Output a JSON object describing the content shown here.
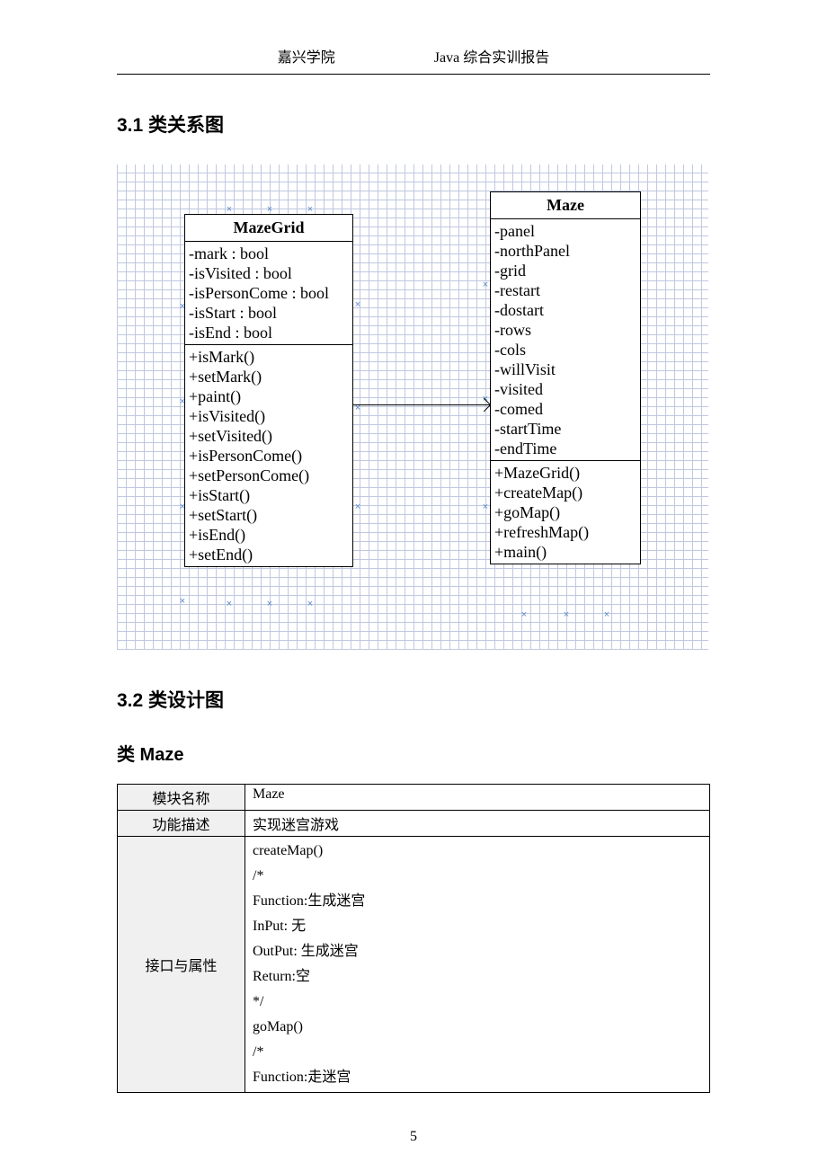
{
  "header": {
    "left": "嘉兴学院",
    "right": "Java 综合实训报告"
  },
  "sections": {
    "s31": "3.1 类关系图",
    "s32": "3.2 类设计图",
    "classMaze": "类 Maze"
  },
  "uml": {
    "mazeGrid": {
      "name": "MazeGrid",
      "attrs": [
        "-mark : bool",
        "-isVisited : bool",
        "-isPersonCome : bool",
        "-isStart : bool",
        "-isEnd : bool"
      ],
      "ops": [
        "+isMark()",
        "+setMark()",
        "+paint()",
        "+isVisited()",
        "+setVisited()",
        "+isPersonCome()",
        "+setPersonCome()",
        "+isStart()",
        "+setStart()",
        "+isEnd()",
        "+setEnd()"
      ]
    },
    "maze": {
      "name": "Maze",
      "attrs": [
        "-panel",
        "-northPanel",
        "-grid",
        "-restart",
        "-dostart",
        "-rows",
        "-cols",
        "-willVisit",
        "-visited",
        "-comed",
        "-startTime",
        "-endTime"
      ],
      "ops": [
        "+MazeGrid()",
        "+createMap()",
        "+goMap()",
        "+refreshMap()",
        "+main()"
      ]
    }
  },
  "table": {
    "rows": {
      "moduleLabel": "模块名称",
      "moduleValue": "Maze",
      "funcLabel": "功能描述",
      "funcValue": "实现迷宫游戏",
      "attrLabel": "接口与属性",
      "attrLines": [
        "createMap()",
        "/*",
        "Function:生成迷宫",
        "InPut:  无",
        "OutPut:  生成迷宫",
        "Return:空",
        "*/",
        "goMap()",
        "/*",
        "Function:走迷宫"
      ]
    }
  },
  "pageNumber": "5",
  "chart_data": {
    "type": "table",
    "title": "UML Class Diagram",
    "classes": [
      {
        "name": "MazeGrid",
        "attributes": [
          "mark:bool",
          "isVisited:bool",
          "isPersonCome:bool",
          "isStart:bool",
          "isEnd:bool"
        ],
        "operations": [
          "isMark()",
          "setMark()",
          "paint()",
          "isVisited()",
          "setVisited()",
          "isPersonCome()",
          "setPersonCome()",
          "isStart()",
          "setStart()",
          "isEnd()",
          "setEnd()"
        ]
      },
      {
        "name": "Maze",
        "attributes": [
          "panel",
          "northPanel",
          "grid",
          "restart",
          "dostart",
          "rows",
          "cols",
          "willVisit",
          "visited",
          "comed",
          "startTime",
          "endTime"
        ],
        "operations": [
          "MazeGrid()",
          "createMap()",
          "goMap()",
          "refreshMap()",
          "main()"
        ]
      }
    ],
    "relations": [
      {
        "from": "MazeGrid",
        "to": "Maze",
        "type": "association"
      }
    ]
  }
}
